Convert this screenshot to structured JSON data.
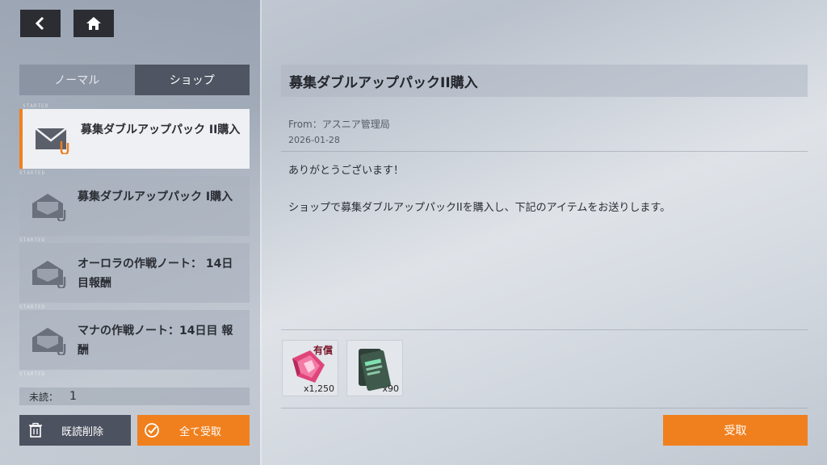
{
  "tabs": [
    {
      "label": "ノーマル",
      "active": false
    },
    {
      "label": "ショップ",
      "active": true
    }
  ],
  "mail_list": [
    {
      "title": "募集ダブルアップパック II購入",
      "read": false,
      "selected": true,
      "tag": "STARTED"
    },
    {
      "title": "募集ダブルアップパック I購入",
      "read": true,
      "selected": false,
      "tag": "STARTED"
    },
    {
      "title": "オーロラの作戦ノート： 14日目報酬",
      "read": true,
      "selected": false,
      "tag": "STARTED"
    },
    {
      "title": "マナの作戦ノート：14日目 報酬",
      "read": true,
      "selected": false,
      "tag": "STARTED"
    }
  ],
  "list_footer_tag": "STARTED",
  "unread": {
    "label": "未読：",
    "count": "1"
  },
  "buttons": {
    "delete_read": "既読削除",
    "claim_all": "全て受取",
    "claim": "受取"
  },
  "detail": {
    "title": "募集ダブルアップパックII購入",
    "from": "From：アスニア管理局",
    "date": "2026-01-28",
    "body_line1": "ありがとうございます！",
    "body_line2": "ショップで募集ダブルアップパックIIを購入し、下記のアイテムをお送りします。"
  },
  "attachments": [
    {
      "name": "paid-gem-icon",
      "badge": "有償",
      "quantity": "x1,250"
    },
    {
      "name": "ticket-pack-icon",
      "badge": "",
      "quantity": "x90"
    }
  ],
  "colors": {
    "accent": "#f0801e",
    "dark_button": "#4d5260",
    "nav_button": "#2b2d33",
    "paid_badge": "#7a1b2d"
  }
}
